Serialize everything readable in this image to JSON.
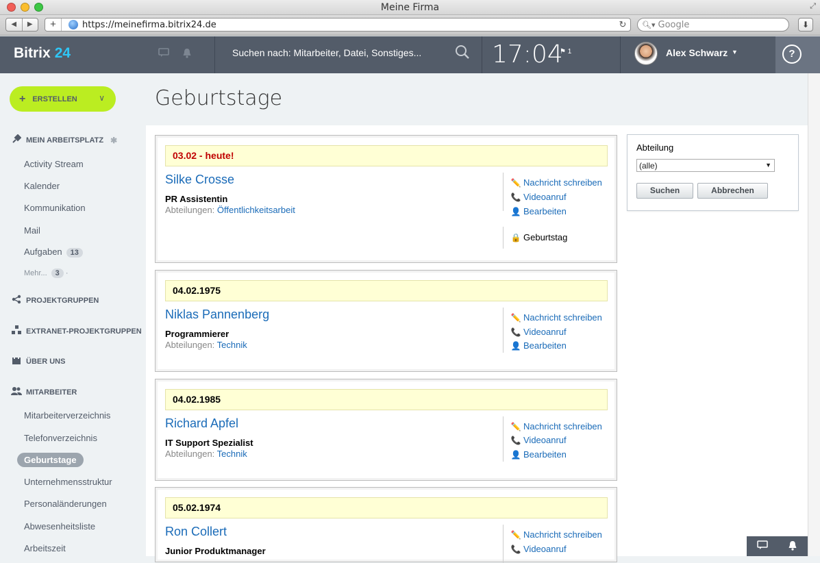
{
  "browser": {
    "window_title": "Meine Firma",
    "url": "https://meinefirma.bitrix24.de",
    "search_placeholder": "Google"
  },
  "header": {
    "logo_text": "Bitrix",
    "logo_num": "24",
    "search_placeholder": "Suchen nach: Mitarbeiter, Datei, Sonstiges...",
    "time": "17:04",
    "flag_count": "1",
    "user_name": "Alex Schwarz",
    "help": "?"
  },
  "sidebar": {
    "create_label": "ERSTELLEN",
    "workspace_title": "MEIN ARBEITSPLATZ",
    "workspace_items": [
      "Activity Stream",
      "Kalender",
      "Kommunikation",
      "Mail",
      "Aufgaben"
    ],
    "tasks_count": "13",
    "more_label": "Mehr...",
    "more_count": "3",
    "projects_title": "PROJEKTGRUPPEN",
    "extranet_title": "EXTRANET-PROJEKTGRUPPEN",
    "about_title": "ÜBER UNS",
    "staff_title": "MITARBEITER",
    "staff_items": [
      "Mitarbeiterverzeichnis",
      "Telefonverzeichnis",
      "Geburtstage",
      "Unternehmensstruktur",
      "Personaländerungen",
      "Abwesenheitsliste",
      "Arbeitszeit"
    ]
  },
  "page": {
    "title": "Geburtstage"
  },
  "labels": {
    "departments": "Abteilungen:",
    "message": "Nachricht schreiben",
    "video": "Videoanruf",
    "edit": "Bearbeiten",
    "birthday": "Geburtstag"
  },
  "birthdays": [
    {
      "date": "03.02 - heute!",
      "name": "Silke Crosse",
      "position": "PR Assistentin",
      "department": "Öffentlichkeitsarbeit"
    },
    {
      "date": "04.02.1975",
      "name": "Niklas Pannenberg",
      "position": "Programmierer",
      "department": "Technik"
    },
    {
      "date": "04.02.1985",
      "name": "Richard Apfel",
      "position": "IT Support Spezialist",
      "department": "Technik"
    },
    {
      "date": "05.02.1974",
      "name": "Ron Collert",
      "position": "Junior Produktmanager",
      "department": ""
    }
  ],
  "filter": {
    "label": "Abteilung",
    "selected": "(alle)",
    "search_button": "Suchen",
    "cancel_button": "Abbrechen"
  },
  "colors": {
    "header_bg": "#535c69",
    "accent": "#2fc6f6",
    "create_btn": "#bbed21",
    "link": "#1a6bb8",
    "today": "#c00000",
    "date_bar": "#ffffd5"
  }
}
